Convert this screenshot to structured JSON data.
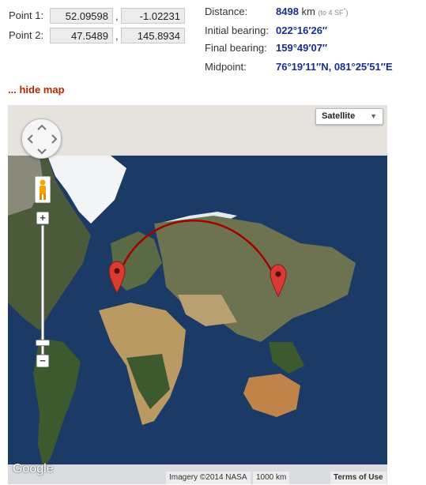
{
  "form": {
    "point1": {
      "label": "Point 1:",
      "lat": "52.09598",
      "lon": "-1.02231"
    },
    "point2": {
      "label": "Point 2:",
      "lat": "47.5489",
      "lon": "145.8934"
    },
    "comma": ","
  },
  "results": {
    "distance": {
      "label": "Distance:",
      "value": "8498",
      "unit": " km",
      "note": "(to 4 SF",
      "note_star": "*",
      "note_end": ")"
    },
    "initial_bearing": {
      "label": "Initial bearing:",
      "value": "022°16′26″"
    },
    "final_bearing": {
      "label": "Final bearing:",
      "value": "159°49′07″"
    },
    "midpoint": {
      "label": "Midpoint:",
      "value": "76°19′11″N, 081°25′51″E"
    }
  },
  "hide_map_link": "... hide map",
  "map": {
    "type_selector": "Satellite",
    "zoom_in": "+",
    "zoom_out": "−",
    "logo": "Google",
    "imagery": "Imagery ©2014 NASA",
    "scale": "1000 km",
    "terms": "Terms of Use",
    "route_color": "#a30000",
    "marker_color": "#d93a33",
    "ocean_color": "#1c3a66",
    "ice_color": "#f2f4f6"
  }
}
